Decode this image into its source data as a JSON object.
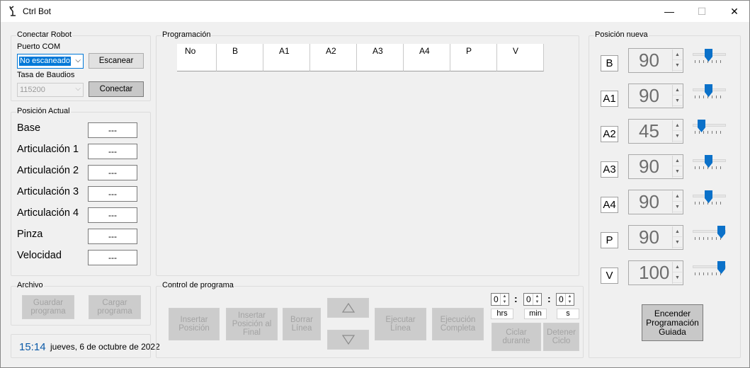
{
  "window": {
    "title": "Ctrl Bot",
    "minimize": "—",
    "maximize": "☐",
    "close": "✕"
  },
  "connect": {
    "group": "Conectar Robot",
    "port_label": "Puerto COM",
    "port_value": "No escaneado",
    "scan": "Escanear",
    "baud_label": "Tasa de Baudios",
    "baud_value": "115200",
    "connect": "Conectar"
  },
  "current": {
    "group": "Posición Actual",
    "rows": [
      {
        "label": "Base",
        "value": "---"
      },
      {
        "label": "Articulación 1",
        "value": "---"
      },
      {
        "label": "Articulación 2",
        "value": "---"
      },
      {
        "label": "Articulación 3",
        "value": "---"
      },
      {
        "label": "Articulación 4",
        "value": "---"
      },
      {
        "label": "Pinza",
        "value": "---"
      },
      {
        "label": "Velocidad",
        "value": "---"
      }
    ]
  },
  "file": {
    "group": "Archivo",
    "save": "Guardar programa",
    "load": "Cargar programa"
  },
  "status": {
    "time": "15:14",
    "date": "jueves, 6 de octubre de 2022"
  },
  "program": {
    "group": "Programación",
    "columns": [
      "No",
      "B",
      "A1",
      "A2",
      "A3",
      "A4",
      "P",
      "V"
    ]
  },
  "control": {
    "group": "Control de programa",
    "insert": "Insertar Posición",
    "insert_end": "Insertar Posición al Final",
    "delete": "Borrar Línea",
    "up": "▲",
    "down": "▼",
    "run_line": "Ejecutar Línea",
    "run_all": "Ejecución Completa",
    "hrs": "0",
    "min": "0",
    "sec": "0",
    "sep1": ":",
    "sep2": ":",
    "hrs_label": "hrs",
    "min_label": "min",
    "sec_label": "s",
    "cycle": "Ciclar durante",
    "stop": "Detener Ciclo"
  },
  "newpos": {
    "group": "Posición nueva",
    "rows": [
      {
        "label": "B",
        "value": "90",
        "slider": 0.5
      },
      {
        "label": "A1",
        "value": "90",
        "slider": 0.5
      },
      {
        "label": "A2",
        "value": "45",
        "slider": 0.25
      },
      {
        "label": "A3",
        "value": "90",
        "slider": 0.5
      },
      {
        "label": "A4",
        "value": "90",
        "slider": 0.5
      },
      {
        "label": "P",
        "value": "90",
        "slider": 1.0
      },
      {
        "label": "V",
        "value": "100",
        "slider": 1.0
      }
    ],
    "guided": "Encender Programación Guiada"
  }
}
